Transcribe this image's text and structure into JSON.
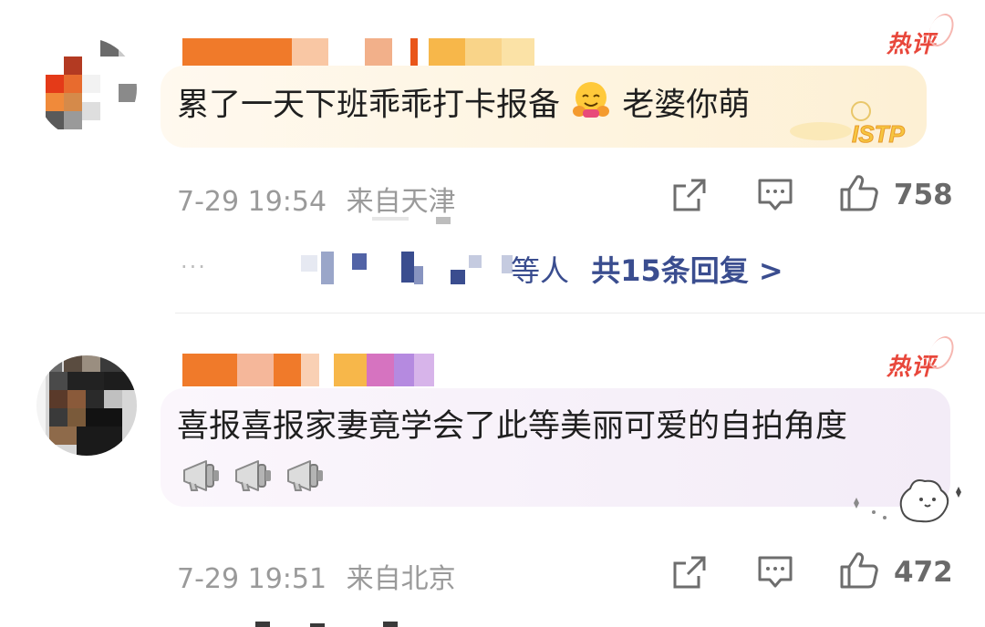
{
  "comments": [
    {
      "badge": "热评",
      "text_before_emoji": "累了一天下班乖乖打卡报备",
      "emoji": "hugging-face-emoji",
      "text_after_emoji": "老婆你萌",
      "timestamp": "7-29 19:54",
      "location": "来自天津",
      "likes": "758",
      "decoration_label": "ISTP"
    },
    {
      "badge": "热评",
      "text": "喜报喜报家妻竟学会了此等美丽可爱的自拍角度",
      "emoji": "megaphone-emoji",
      "emoji_count": 3,
      "timestamp": "7-29 19:51",
      "location": "来自北京",
      "likes": "472"
    }
  ],
  "replies": {
    "ellipsis": "···",
    "partial_name": "等人",
    "summary": "共15条回复 >"
  },
  "colors": {
    "accent_blue": "#3a4d8f",
    "badge_red": "#e8473b",
    "meta_gray": "#9a9a9a"
  },
  "icons": [
    "share-icon",
    "comment-icon",
    "like-icon"
  ]
}
